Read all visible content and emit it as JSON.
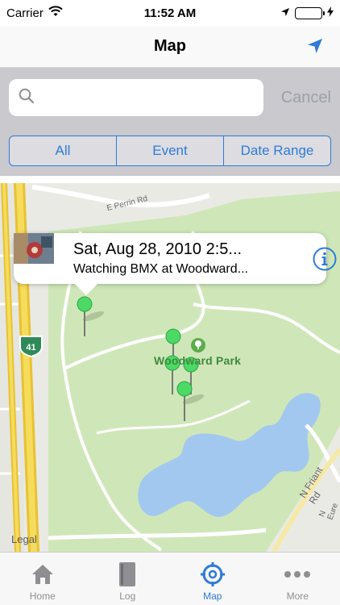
{
  "status": {
    "carrier": "Carrier",
    "time": "11:52 AM"
  },
  "nav": {
    "title": "Map"
  },
  "search": {
    "placeholder": "",
    "cancel_label": "Cancel"
  },
  "segments": [
    {
      "label": "All"
    },
    {
      "label": "Event"
    },
    {
      "label": "Date Range"
    }
  ],
  "map": {
    "callout": {
      "title": "Sat, Aug 28, 2010 2:5...",
      "subtitle": "Watching BMX at Woodward..."
    },
    "park_label": "Woodward Park",
    "route_shield": "41",
    "legal": "Legal",
    "roads": {
      "perrin": "E Perrin Rd",
      "friant": "N Friant Rd",
      "eure": "N Eure"
    }
  },
  "tabs": [
    {
      "label": "Home",
      "icon": "home-icon"
    },
    {
      "label": "Log",
      "icon": "book-icon"
    },
    {
      "label": "Map",
      "icon": "map-target-icon",
      "active": true
    },
    {
      "label": "More",
      "icon": "more-dots-icon"
    }
  ],
  "colors": {
    "accent": "#2f7bd8",
    "park": "#cfe7b8",
    "water": "#a3c8f0",
    "pin": "#4cd964"
  }
}
